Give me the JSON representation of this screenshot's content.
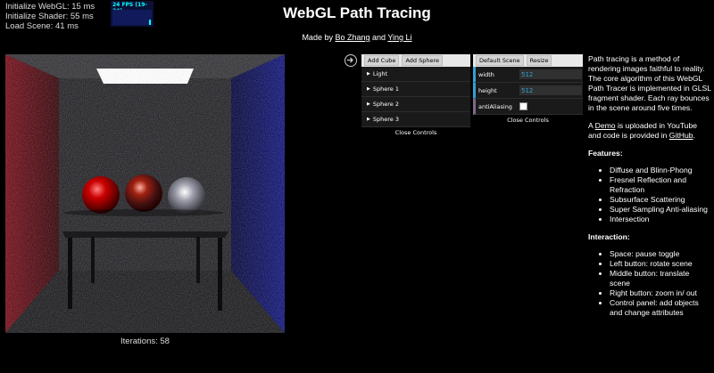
{
  "timing": {
    "webgl": "Initialize WebGL: 15 ms",
    "shader": "Initialize Shader: 55 ms",
    "scene": "Load Scene: 41 ms"
  },
  "fps": {
    "label": "24 FPS (19-24)"
  },
  "title": "WebGL Path Tracing",
  "byline": {
    "prefix": "Made by ",
    "author1": "Bo Zhang",
    "and": " and ",
    "author2": "Ying Li"
  },
  "viewport": {
    "iterations": "Iterations: 58"
  },
  "objects_panel": {
    "add_cube": "Add Cube",
    "add_sphere": "Add Sphere",
    "items": [
      "Light",
      "Sphere 1",
      "Sphere 2",
      "Sphere 3"
    ],
    "close": "Close Controls"
  },
  "scene_panel": {
    "default_scene": "Default Scene",
    "resize": "Resize",
    "width_label": "width",
    "width_value": "512",
    "height_label": "height",
    "height_value": "512",
    "antialiasing_label": "antiAliasing",
    "antialiasing_checked": false,
    "close": "Close Controls"
  },
  "description": {
    "intro": "Path tracing is a method of rendering images faithful to reality. The core algorithm of this WebGL Path Tracer is implemented in GLSL fragment shader. Each ray bounces in the scene around five times.",
    "demo_prefix": "A ",
    "demo_link": "Demo",
    "demo_mid": " is uploaded in YouTube and code is provided in ",
    "github_link": "GitHub",
    "demo_suffix": ".",
    "features_heading": "Features:",
    "features": [
      "Diffuse and Blinn-Phong",
      "Fresnel Reflection and Refraction",
      "Subsurface Scattering",
      "Super Sampling Anti-aliasing",
      "Intersection"
    ],
    "interaction_heading": "Interaction:",
    "interaction": [
      "Space: pause toggle",
      "Left button: rotate scene",
      "Middle button: translate scene",
      "Right button: zoom in/ out",
      "Control panel: add objects and change attributes"
    ]
  },
  "colors": {
    "left_wall": "#8a1a22",
    "right_wall": "#1c1f8a",
    "panel_accent": "#2fa1d6"
  }
}
